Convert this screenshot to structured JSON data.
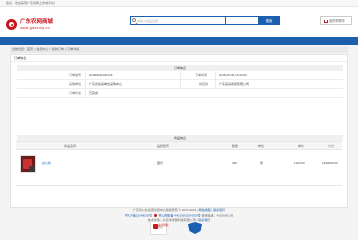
{
  "topbar": {
    "welcome": "您好，欢迎来到广东省网上商城平台！"
  },
  "header": {
    "logo_title": "广东农网商城",
    "logo_domain": "www.gdsenty.cn"
  },
  "search": {
    "placeholder": "请输入商品名称",
    "button_label": "搜索"
  },
  "cart": {
    "label": "我的购物车"
  },
  "breadcrumb": {
    "text": "当前位置：首页 > 会员中心 > 我的订单 > 订单详情"
  },
  "order": {
    "card_title": "订单信息",
    "section_title": "订单信息",
    "fields": {
      "order_no_label": "订单编号",
      "order_no": "20180630100146",
      "order_time_label": "下单时间",
      "order_time": "2018-06-30 16:22:00",
      "buyer_label": "采购单位",
      "buyer": "广东省某某单位采购中心",
      "seller_label": "供应商",
      "seller": "广东某某商贸有限公司",
      "status_label": "订单状态",
      "status": "已完成"
    }
  },
  "goods": {
    "section_title": "商品信息",
    "columns": [
      "商品名称",
      "品牌型号",
      "数量",
      "单位",
      "单价",
      "小计"
    ],
    "rows": [
      {
        "name": "办公椅",
        "brand": "国光",
        "qty": "440",
        "unit": "张",
        "price": "1100.00",
        "subtotal": "1100000.00"
      }
    ]
  },
  "footer": {
    "line1": "广东省公共资源交易中心版权所有 © 2015-2018",
    "line1_link_1": "网站地图",
    "line1_link_2": "联系我们",
    "line2_icp": "粤ICP备15048503号",
    "line2_police": "粤公网安备 44010602004205号",
    "line2_tel": "咨询电话：4001690105",
    "line3": "技术支持：北京零零捌科技有限公司",
    "line3_link": "联系我们",
    "badge_a_title": "政府网站",
    "badge_a_sub": "找错"
  },
  "colors": {
    "brand_red": "#c8161d",
    "brand_blue": "#1b5fae"
  }
}
